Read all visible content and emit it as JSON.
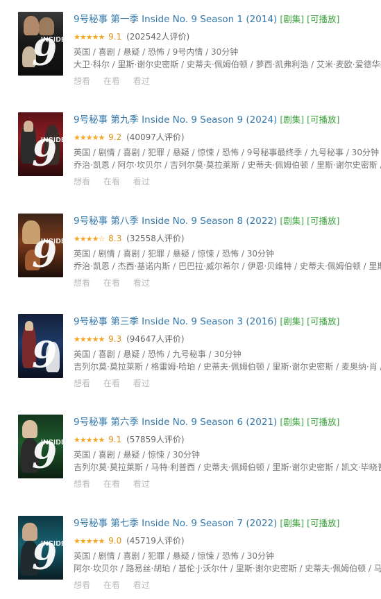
{
  "items": [
    {
      "title": "9号秘事 第一季 Inside No. 9 Season 1 (2014)",
      "tag_series": "[剧集]",
      "tag_playable": "[可播放]",
      "stars": "★★★★★",
      "score": "9.1",
      "votes": "(202542人评价)",
      "meta": "英国 / 喜剧 / 悬疑 / 恐怖 / 9号内情 / 30分钟",
      "cast": "大卫·科尔 / 里斯·谢尔史密斯 / 史蒂夫·佩姆伯顿 / 萝西·凯弗利浩 / 艾米·麦欧·爱德华兹",
      "actions": [
        "想看",
        "在看",
        "看过"
      ],
      "poster_text": "INSIDE"
    },
    {
      "title": "9号秘事 第九季 Inside No. 9 Season 9 (2024)",
      "tag_series": "[剧集]",
      "tag_playable": "[可播放]",
      "stars": "★★★★★",
      "score": "9.2",
      "votes": "(40097人评价)",
      "meta": "英国 / 剧情 / 喜剧 / 犯罪 / 悬疑 / 惊悚 / 恐怖 / 9号秘事最终季 / 九号秘事 / 30分钟",
      "cast": "乔治·凯恩 / 阿尔·坎贝尔 / 吉列尔莫·莫拉莱斯 / 史蒂夫·佩姆伯顿 / 里斯·谢尔史密斯 / 杰",
      "actions": [
        "想看",
        "在看",
        "看过"
      ],
      "poster_text": "INSIDE"
    },
    {
      "title": "9号秘事 第八季 Inside No. 9 Season 8 (2022)",
      "tag_series": "[剧集]",
      "tag_playable": "[可播放]",
      "stars": "★★★★☆",
      "score": "8.3",
      "votes": "(32558人评价)",
      "meta": "英国 / 剧情 / 喜剧 / 犯罪 / 悬疑 / 惊悚 / 恐怖 / 30分钟",
      "cast": "乔治·凯恩 / 杰西·基诺内斯 / 巴巴拉·威尔希尔 / 伊恩·贝维特 / 史蒂夫·佩姆伯顿 / 里斯",
      "actions": [
        "想看",
        "在看",
        "看过"
      ],
      "poster_text": "INSIDE"
    },
    {
      "title": "9号秘事 第三季 Inside No. 9 Season 3 (2016)",
      "tag_series": "[剧集]",
      "tag_playable": "[可播放]",
      "stars": "★★★★★",
      "score": "9.3",
      "votes": "(94647人评价)",
      "meta": "英国 / 喜剧 / 悬疑 / 恐怖 / 九号秘事 / 30分钟",
      "cast": "吉列尔莫·莫拉莱斯 / 格雷姆·哈珀 / 史蒂夫·佩姆伯顿 / 里斯·谢尔史密斯 / 麦奥纳·肖 / 杰",
      "actions": [
        "想看",
        "在看",
        "看过"
      ],
      "poster_text": ""
    },
    {
      "title": "9号秘事 第六季 Inside No. 9 Season 6 (2021)",
      "tag_series": "[剧集]",
      "tag_playable": "[可播放]",
      "stars": "★★★★★",
      "score": "9.1",
      "votes": "(57859人评价)",
      "meta": "英国 / 喜剧 / 悬疑 / 惊悚 / 30分钟",
      "cast": "吉列尔莫·莫拉莱斯 / 马特·利普西 / 史蒂夫·佩姆伯顿 / 里斯·谢尔史密斯 / 凯文·毕晓普",
      "actions": [
        "想看",
        "在看",
        "看过"
      ],
      "poster_text": "INSIDE"
    },
    {
      "title": "9号秘事 第七季 Inside No. 9 Season 7 (2022)",
      "tag_series": "[剧集]",
      "tag_playable": "[可播放]",
      "stars": "★★★★★",
      "score": "9.0",
      "votes": "(45719人评价)",
      "meta": "英国 / 剧情 / 喜剧 / 犯罪 / 悬疑 / 惊悚 / 恐怖 / 30分钟",
      "cast": "阿尔·坎贝尔 / 路易丝·胡珀 / 基伦·J·沃尔什 / 里斯·谢尔史密斯 / 史蒂夫·佩姆伯顿 / 马克",
      "actions": [
        "想看",
        "在看",
        "看过"
      ],
      "poster_text": "INSIDE"
    }
  ],
  "colors": {
    "title": "#3377aa",
    "tag": "#3ca23c",
    "star": "#f5a623",
    "meta": "#777777"
  }
}
